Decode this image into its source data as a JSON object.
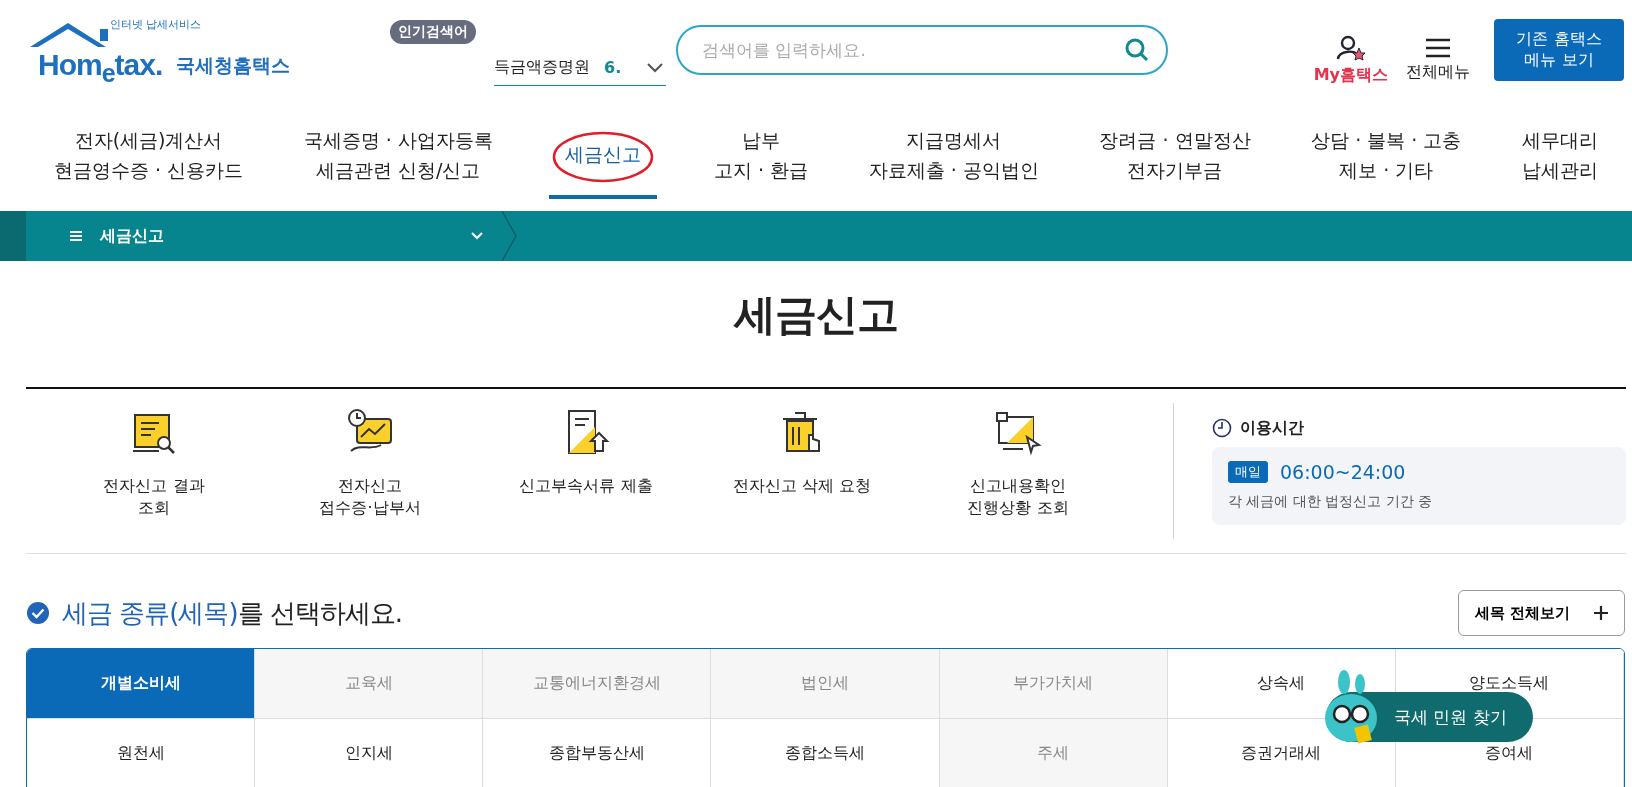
{
  "logo": {
    "tagline": "인터넷 납세서비스",
    "brand": "Hom$_{e}$tax.",
    "name": "국세청홈택스"
  },
  "popular": {
    "badge": "인기검색어",
    "keyword": "득금액증명원",
    "next_rank": "6."
  },
  "search": {
    "placeholder": "검색어를 입력하세요."
  },
  "header_links": [
    {
      "kind": "my",
      "label": "My홈택스"
    },
    {
      "kind": "menu",
      "label": "전체메뉴"
    }
  ],
  "legacy_button": {
    "lines": [
      "기존 홈택스",
      "메뉴 보기"
    ]
  },
  "nav": [
    {
      "lines": [
        "전자(세금)계산서",
        "현금영수증 · 신용카드"
      ],
      "selected": false
    },
    {
      "lines": [
        "국세증명 · 사업자등록",
        "세금관련 신청/신고"
      ],
      "selected": false
    },
    {
      "lines": [
        "세금신고"
      ],
      "selected": true
    },
    {
      "lines": [
        "납부",
        "고지 · 환급"
      ],
      "selected": false
    },
    {
      "lines": [
        "지급명세서",
        "자료제출 · 공익법인"
      ],
      "selected": false
    },
    {
      "lines": [
        "장려금 · 연말정산",
        "전자기부금"
      ],
      "selected": false
    },
    {
      "lines": [
        "상담 · 불복 · 고충",
        "제보 · 기타"
      ],
      "selected": false
    },
    {
      "lines": [
        "세무대리",
        "납세관리"
      ],
      "selected": false
    }
  ],
  "breadcrumb": {
    "label": "세금신고"
  },
  "page_title": "세금신고",
  "services": [
    {
      "kind": "result",
      "lines": [
        "전자신고 결과",
        "조회"
      ]
    },
    {
      "kind": "receipt",
      "lines": [
        "전자신고",
        "접수증·납부서"
      ]
    },
    {
      "kind": "upload",
      "lines": [
        "신고부속서류 제출"
      ]
    },
    {
      "kind": "delete",
      "lines": [
        "전자신고 삭제 요청"
      ]
    },
    {
      "kind": "check",
      "lines": [
        "신고내용확인",
        "진행상황 조회"
      ]
    }
  ],
  "hours": {
    "title": "이용시간",
    "badge": "매일",
    "time": "06:00~24:00",
    "note": "각 세금에 대한 법정신고 기간 중"
  },
  "tax_select": {
    "heading_highlight": "세금 종류(세목)",
    "heading_rest": "를 선택하세요.",
    "view_all_button": "세목 전체보기"
  },
  "tax_types": [
    [
      {
        "label": "개별소비세",
        "selected": true,
        "disabled": false
      },
      {
        "label": "교육세",
        "selected": false,
        "disabled": true
      },
      {
        "label": "교통에너지환경세",
        "selected": false,
        "disabled": true
      },
      {
        "label": "법인세",
        "selected": false,
        "disabled": true
      },
      {
        "label": "부가가치세",
        "selected": false,
        "disabled": true
      },
      {
        "label": "상속세",
        "selected": false,
        "disabled": false
      },
      {
        "label": "양도소득세",
        "selected": false,
        "disabled": false
      }
    ],
    [
      {
        "label": "원천세",
        "selected": false,
        "disabled": false
      },
      {
        "label": "인지세",
        "selected": false,
        "disabled": false
      },
      {
        "label": "종합부동산세",
        "selected": false,
        "disabled": false
      },
      {
        "label": "종합소득세",
        "selected": false,
        "disabled": false
      },
      {
        "label": "주세",
        "selected": false,
        "disabled": true
      },
      {
        "label": "증권거래세",
        "selected": false,
        "disabled": false
      },
      {
        "label": "증여세",
        "selected": false,
        "disabled": false
      }
    ]
  ],
  "chat_button": {
    "label": "국세 민원 찾기"
  }
}
